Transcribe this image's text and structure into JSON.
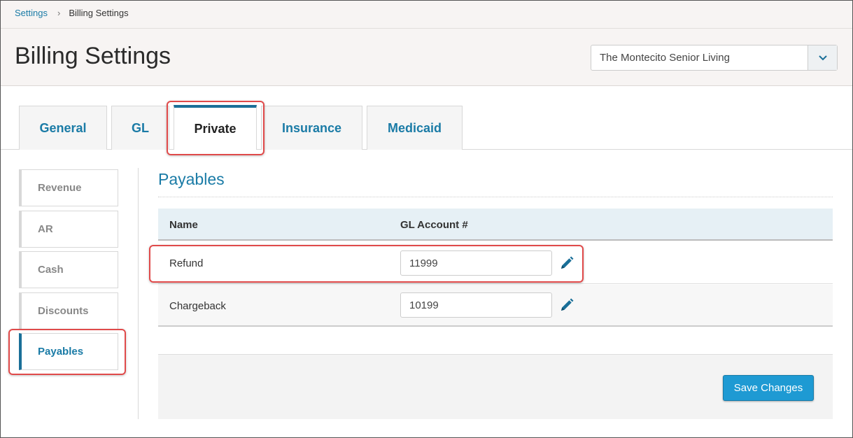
{
  "breadcrumb": {
    "parent": "Settings",
    "separator": "›",
    "current": "Billing Settings"
  },
  "page": {
    "title": "Billing Settings"
  },
  "facility_select": {
    "value": "The Montecito Senior Living",
    "icon": "chevron-down-icon"
  },
  "tabs": [
    {
      "label": "General",
      "active": false
    },
    {
      "label": "GL",
      "active": false
    },
    {
      "label": "Private",
      "active": true
    },
    {
      "label": "Insurance",
      "active": false
    },
    {
      "label": "Medicaid",
      "active": false
    }
  ],
  "side_nav": [
    {
      "label": "Revenue",
      "active": false
    },
    {
      "label": "AR",
      "active": false
    },
    {
      "label": "Cash",
      "active": false
    },
    {
      "label": "Discounts",
      "active": false
    },
    {
      "label": "Payables",
      "active": true
    }
  ],
  "section": {
    "title": "Payables"
  },
  "table": {
    "headers": {
      "name": "Name",
      "gl_account": "GL Account #"
    },
    "rows": [
      {
        "name": "Refund",
        "gl_account": "11999",
        "action_icon": "pencil-icon"
      },
      {
        "name": "Chargeback",
        "gl_account": "10199",
        "action_icon": "pencil-icon"
      }
    ]
  },
  "footer": {
    "save_label": "Save Changes"
  },
  "colors": {
    "link": "#1a7ba6",
    "accent_dark": "#1a6f98",
    "highlight": "#e04a4a",
    "button": "#1e9ad3",
    "table_header": "#e6f0f5"
  }
}
